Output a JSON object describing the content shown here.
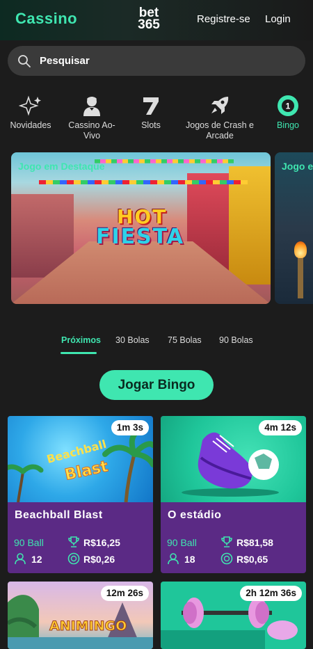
{
  "header": {
    "brand": "Cassino",
    "logo_line1": "bet",
    "logo_line2": "365",
    "register": "Registre-se",
    "login": "Login"
  },
  "search": {
    "placeholder": "Pesquisar"
  },
  "categories": [
    {
      "label": "Novidades",
      "icon": "sparkle-icon"
    },
    {
      "label": "Cassino Ao-Vivo",
      "icon": "dealer-icon"
    },
    {
      "label": "Slots",
      "icon": "seven-icon"
    },
    {
      "label": "Jogos de Crash e Arcade",
      "icon": "rocket-icon"
    },
    {
      "label": "Bingo",
      "icon": "bingo-ball-icon",
      "active": true
    }
  ],
  "featured": {
    "label": "Jogo em Destaque",
    "game_logo_line1": "HOT",
    "game_logo_line2": "FIESTA",
    "next_label": "Jogo e"
  },
  "tabs": [
    {
      "label": "Próximos",
      "active": true
    },
    {
      "label": "30 Bolas"
    },
    {
      "label": "75 Bolas"
    },
    {
      "label": "90 Bolas"
    }
  ],
  "play_button": "Jogar Bingo",
  "games": [
    {
      "timer": "1m 3s",
      "title": "Beachball Blast",
      "art_line1": "Beachball",
      "art_line2": "Blast",
      "ball": "90 Ball",
      "prize": "R$16,25",
      "players": "12",
      "cost": "R$0,26"
    },
    {
      "timer": "4m 12s",
      "title": "O estádio",
      "ball": "90 Ball",
      "prize": "R$81,58",
      "players": "18",
      "cost": "R$0,65"
    },
    {
      "timer": "12m 26s",
      "art_title": "ANIMINGO"
    },
    {
      "timer": "2h 12m 36s"
    }
  ],
  "colors": {
    "accent": "#3fe6b0",
    "card_purple": "#5b2a85",
    "background": "#1c1c1c"
  }
}
